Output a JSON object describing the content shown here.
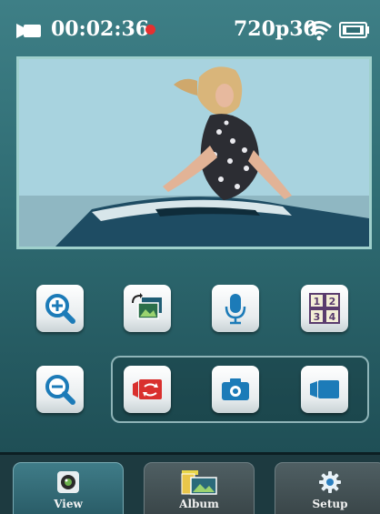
{
  "status_bar": {
    "recording_time": "00:02:36",
    "resolution": "720p30",
    "icons": [
      "camcorder-icon",
      "record-dot-icon",
      "wifi-icon",
      "battery-icon"
    ]
  },
  "preview": {
    "description_icon": "live-preview-image"
  },
  "controls": {
    "row1": [
      "zoom-in-icon",
      "switch-camera-icon",
      "microphone-icon",
      "multi-view-icon"
    ],
    "row2": [
      "zoom-out-icon",
      "loop-mode-icon",
      "photo-mode-icon",
      "video-mode-icon"
    ],
    "multiview_numbers": [
      "1",
      "2",
      "3",
      "4"
    ]
  },
  "tabs": [
    {
      "label": "View",
      "icon": "camera-lens-icon",
      "active": true
    },
    {
      "label": "Album",
      "icon": "album-icon",
      "active": false
    },
    {
      "label": "Setup",
      "icon": "gear-icon",
      "active": false
    }
  ],
  "colors": {
    "accent": "#2f6c73",
    "record": "#e53030",
    "mode_red": "#d9302e",
    "icon_blue": "#1c7bb8"
  }
}
